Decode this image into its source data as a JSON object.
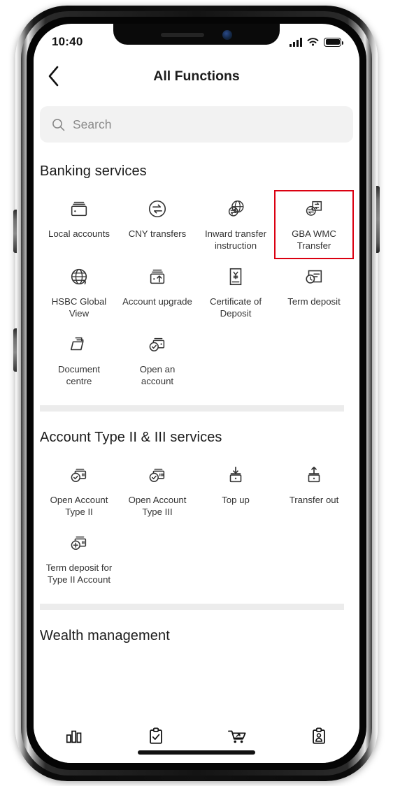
{
  "status_bar": {
    "time": "10:40",
    "signal_icon": "signal-bars-icon",
    "wifi_icon": "wifi-icon",
    "battery_icon": "battery-full-icon"
  },
  "nav": {
    "back_icon": "chevron-left-icon",
    "title": "All Functions"
  },
  "search": {
    "icon": "search-icon",
    "placeholder": "Search",
    "value": ""
  },
  "sections": [
    {
      "title": "Banking services",
      "items": [
        {
          "label": "Local accounts",
          "icon": "wallet-icon",
          "highlighted": false
        },
        {
          "label": "CNY transfers",
          "icon": "transfer-circle-icon",
          "highlighted": false
        },
        {
          "label": "Inward transfer instruction",
          "icon": "globe-exchange-icon",
          "highlighted": false
        },
        {
          "label": "GBA WMC Transfer",
          "icon": "exchange-document-icon",
          "highlighted": true
        },
        {
          "label": "HSBC Global View",
          "icon": "globe-icon",
          "highlighted": false
        },
        {
          "label": "Account upgrade",
          "icon": "wallet-up-arrow-icon",
          "highlighted": false
        },
        {
          "label": "Certificate of Deposit",
          "icon": "yen-certificate-icon",
          "highlighted": false
        },
        {
          "label": "Term deposit",
          "icon": "clock-document-icon",
          "highlighted": false
        },
        {
          "label": "Document centre",
          "icon": "folder-icon",
          "highlighted": false
        },
        {
          "label": "Open an account",
          "icon": "wallet-check-icon",
          "highlighted": false
        }
      ]
    },
    {
      "title": "Account Type II & III services",
      "items": [
        {
          "label": "Open Account Type II",
          "icon": "wallet-check-card-icon",
          "highlighted": false
        },
        {
          "label": "Open Account Type III",
          "icon": "wallet-check-card3-icon",
          "highlighted": false
        },
        {
          "label": "Top up",
          "icon": "arrow-down-box-icon",
          "highlighted": false
        },
        {
          "label": "Transfer out",
          "icon": "arrow-up-box-icon",
          "highlighted": false
        },
        {
          "label": "Term deposit for Type II Account",
          "icon": "wallet-plus-card-icon",
          "highlighted": false
        }
      ]
    },
    {
      "title": "Wealth management",
      "items": []
    }
  ],
  "tabbar": {
    "tabs": [
      {
        "icon": "bar-chart-icon",
        "active": false
      },
      {
        "icon": "clipboard-check-icon",
        "active": true
      },
      {
        "icon": "shopping-cart-icon",
        "active": false
      },
      {
        "icon": "clipboard-person-icon",
        "active": false
      }
    ]
  },
  "colors": {
    "highlight": "#db0011",
    "text": "#333333",
    "search_bg": "#f2f2f2",
    "divider": "#ececec"
  }
}
